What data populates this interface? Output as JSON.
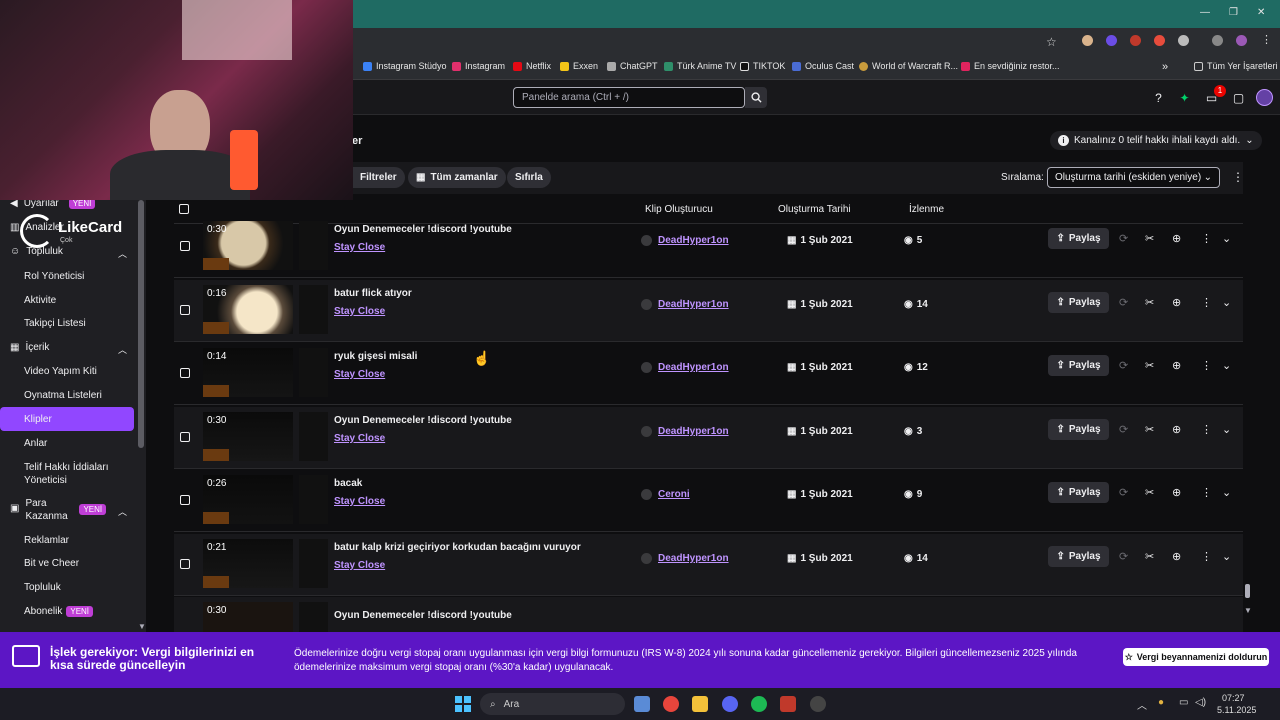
{
  "browser": {
    "bookmarks": [
      "Instagram Stüdyo",
      "Instagram",
      "Netflix",
      "Exxen",
      "ChatGPT",
      "Türk Anime TV",
      "TIKTOK",
      "Oculus Cast",
      "World of Warcraft R...",
      "En sevdiğiniz restor..."
    ],
    "all_bookmarks": "Tüm Yer İşaretleri"
  },
  "header": {
    "search_placeholder": "Panelde arama (Ctrl + /)",
    "notif_count": "1"
  },
  "overlay": {
    "brand": "LikeCard",
    "brand_sub": "Çok"
  },
  "sidebar": {
    "uyarilar": "Uyarılar",
    "yeni": "YENİ",
    "analizler": "Analizler",
    "topluluk": "Topluluk",
    "rol": "Rol Yöneticisi",
    "aktivite": "Aktivite",
    "takipci": "Takipçi Listesi",
    "icerik": "İçerik",
    "video": "Video Yapım Kiti",
    "oynatma": "Oynatma Listeleri",
    "klipler": "Klipler",
    "anlar": "Anlar",
    "telif": "Telif Hakkı İddiaları Yöneticisi",
    "para": "Para Kazanma",
    "reklamlar": "Reklamlar",
    "bit": "Bit ve Cheer",
    "topluluk2": "Topluluk",
    "abonelik": "Abonelik"
  },
  "main": {
    "page_title_tail": "er",
    "notice": "Kanalınız 0 telif hakkı ihlali kaydı aldı.",
    "filters": "Filtreler",
    "all_time": "Tüm zamanlar",
    "reset": "Sıfırla",
    "sort_label": "Sıralama:",
    "sort_value": "Oluşturma tarihi (eskiden yeniye)",
    "columns": {
      "creator": "Klip Oluşturucu",
      "date": "Oluşturma Tarihi",
      "views": "İzlenme"
    },
    "share": "Paylaş",
    "rows": [
      {
        "dur": "0:30",
        "title": "Oyun Denemeceler !discord !youtube",
        "game": "Stay Close",
        "creator": "DeadHyper1on",
        "date": "1 Şub 2021",
        "views": "5"
      },
      {
        "dur": "0:16",
        "title": "batur flick atıyor",
        "game": "Stay Close",
        "creator": "DeadHyper1on",
        "date": "1 Şub 2021",
        "views": "14"
      },
      {
        "dur": "0:14",
        "title": "ryuk gişesi misali",
        "game": "Stay Close",
        "creator": "DeadHyper1on",
        "date": "1 Şub 2021",
        "views": "12"
      },
      {
        "dur": "0:30",
        "title": "Oyun Denemeceler !discord !youtube",
        "game": "Stay Close",
        "creator": "DeadHyper1on",
        "date": "1 Şub 2021",
        "views": "3"
      },
      {
        "dur": "0:26",
        "title": "bacak",
        "game": "Stay Close",
        "creator": "Ceroni",
        "date": "1 Şub 2021",
        "views": "9"
      },
      {
        "dur": "0:21",
        "title": "batur kalp krizi geçiriyor korkudan bacağını vuruyor",
        "game": "Stay Close",
        "creator": "DeadHyper1on",
        "date": "1 Şub 2021",
        "views": "14"
      }
    ],
    "partial_row": {
      "dur": "0:30",
      "title": "Oyun Denemeceler !discord !youtube"
    }
  },
  "banner": {
    "title": "İşlek gerekiyor: Vergi bilgilerinizi en kısa sürede güncelleyin",
    "text": "Ödemelerinize doğru vergi stopaj oranı uygulanması için vergi bilgi formunuzu (IRS W-8) 2024 yılı sonuna kadar güncellemeniz gerekiyor. Bilgileri güncellemezseniz 2025 yılında ödemelerinize maksimum vergi stopaj oranı (%30'a kadar) uygulanacak.",
    "button": "Vergi beyannamenizi doldurun"
  },
  "taskbar": {
    "search": "Ara",
    "time": "07:27",
    "date": "5.11.2025"
  }
}
